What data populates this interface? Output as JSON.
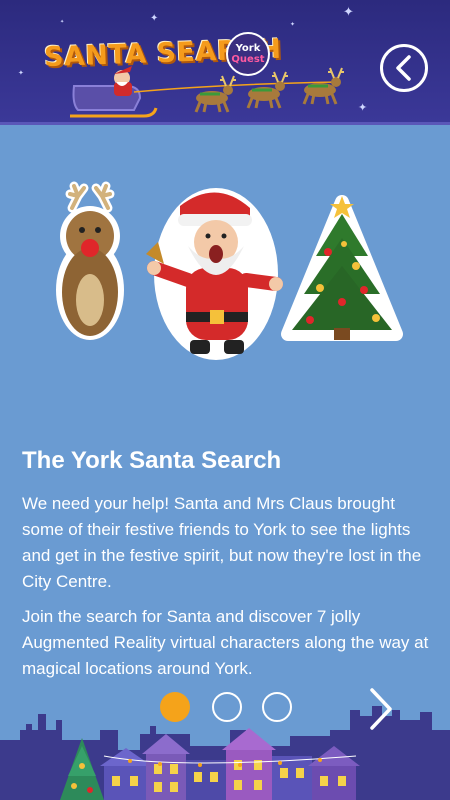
{
  "header": {
    "logo_text": "SANTA SEARCH",
    "badge_line1": "York",
    "badge_line2": "Quest",
    "back_icon": "chevron-left-icon"
  },
  "content": {
    "title": "The York Santa Search",
    "paragraph1": "We need your help! Santa and Mrs Claus brought some of their festive friends to York to see the lights and get in the festive spirit, but now they're lost in the City Centre.",
    "paragraph2": "Join the search for Santa and discover 7 jolly Augmented Reality virtual characters along the way at magical locations around York."
  },
  "pager": {
    "total": 3,
    "active_index": 0,
    "next_icon": "chevron-right-icon"
  },
  "colors": {
    "background": "#6a9bd2",
    "header": "#2c2a7e",
    "accent": "#f5a31a",
    "text": "#ffffff"
  }
}
